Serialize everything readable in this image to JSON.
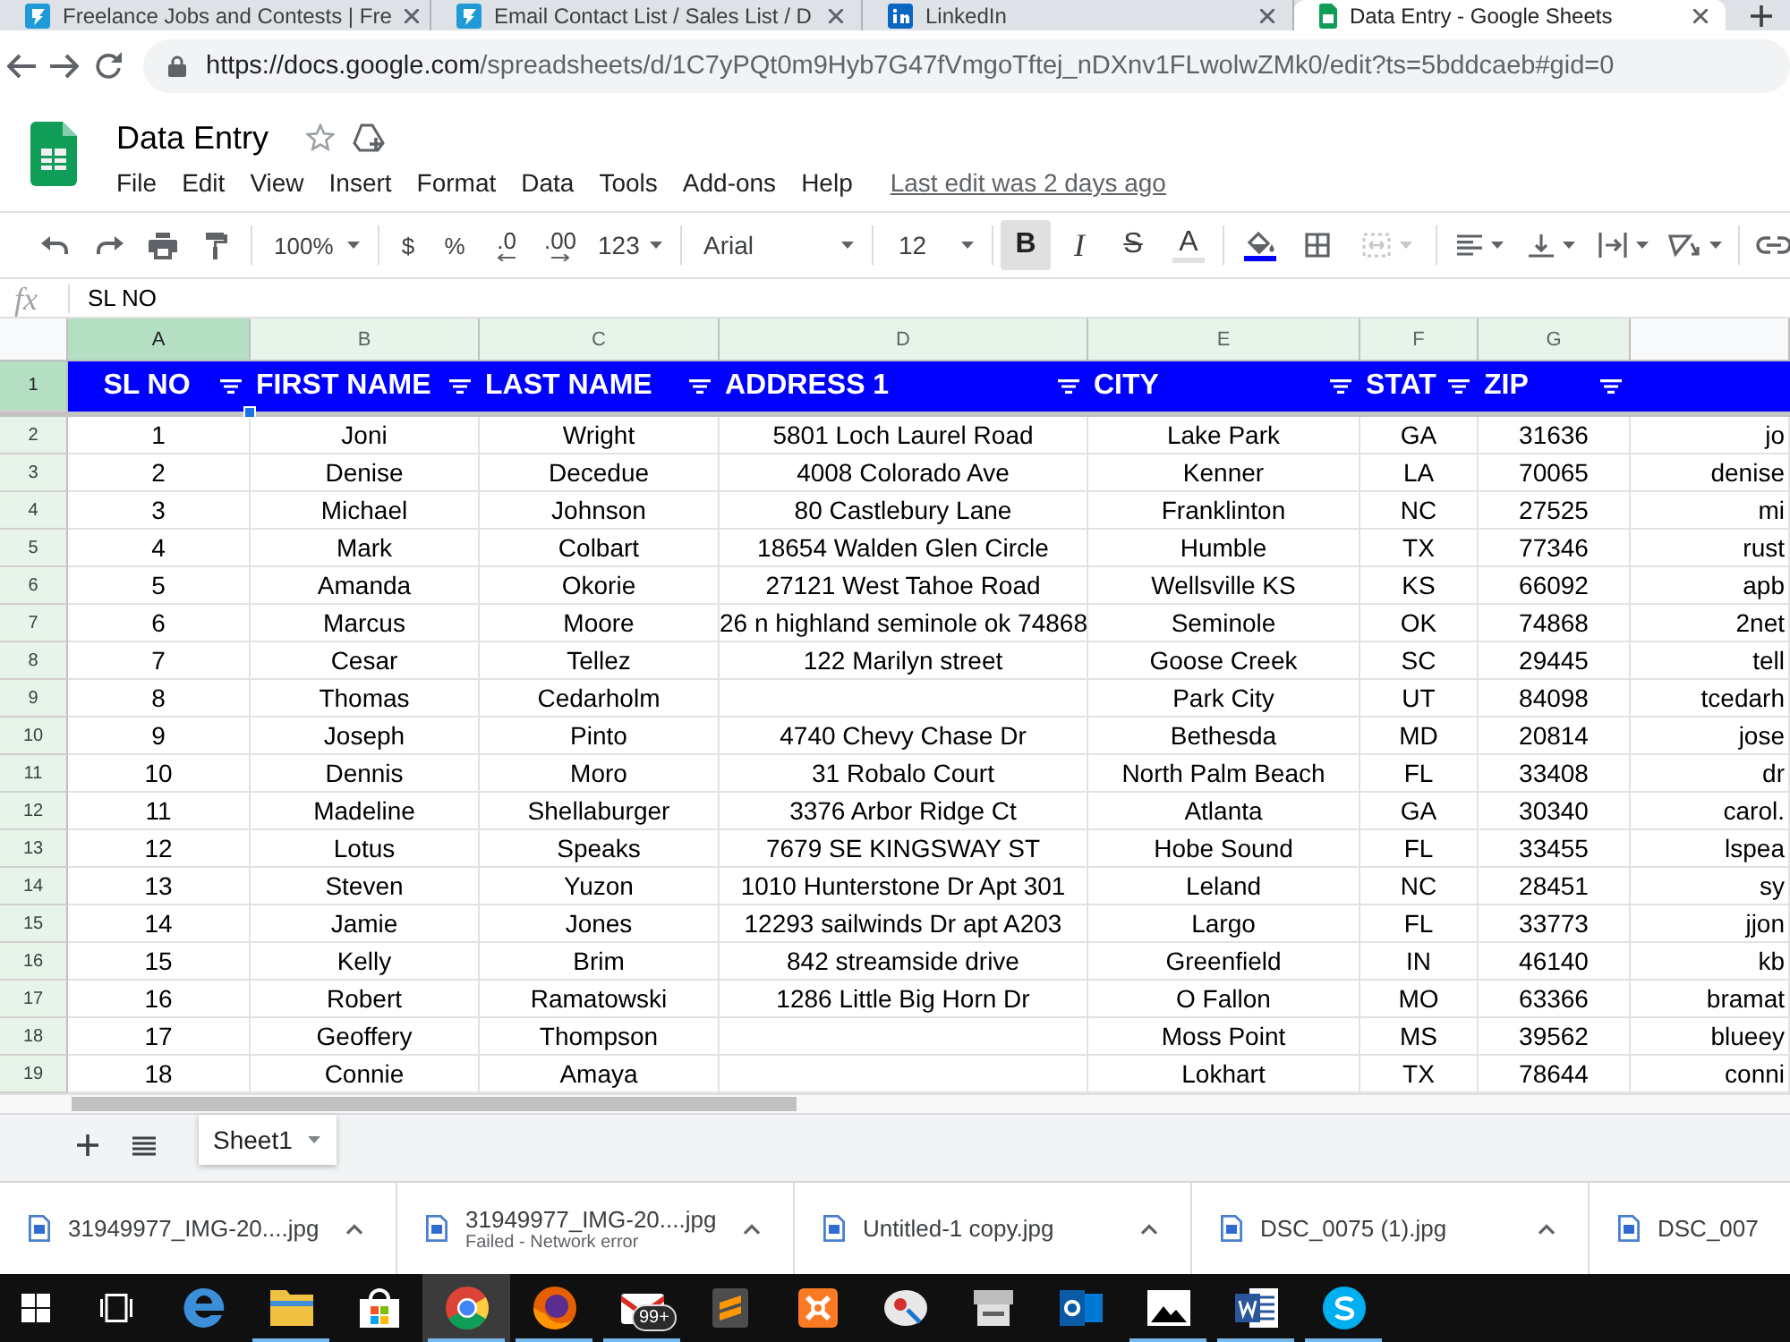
{
  "browser": {
    "tabs": [
      {
        "title": "Freelance Jobs and Contests | Fre",
        "kind": "freelancer",
        "selected": false
      },
      {
        "title": "Email Contact List / Sales List / D",
        "kind": "freelancer",
        "selected": false
      },
      {
        "title": "LinkedIn",
        "kind": "linkedin",
        "selected": false
      },
      {
        "title": "Data Entry - Google Sheets",
        "kind": "sheets",
        "selected": true
      }
    ],
    "address_bar": {
      "host": "https://docs.google.com",
      "path": "/spreadsheets/d/1C7yPQt0m9Hyb7G47fVmgoTftej_nDXnv1FLwolwZMk0/edit?ts=5bddcaeb#gid=0"
    }
  },
  "app": {
    "title": "Data Entry",
    "menu": [
      "File",
      "Edit",
      "View",
      "Insert",
      "Format",
      "Data",
      "Tools",
      "Add-ons",
      "Help"
    ],
    "last_edit": "Last edit was 2 days ago"
  },
  "toolbar": {
    "history": [
      {
        "kind": "undo"
      },
      {
        "kind": "redo"
      },
      {
        "kind": "print"
      },
      {
        "kind": "paint_format"
      }
    ],
    "zoom": "100%",
    "number": [
      {
        "kind": "currency",
        "label": "$"
      },
      {
        "kind": "percent",
        "label": "%"
      },
      {
        "kind": "decimal_less",
        "label": ".0"
      },
      {
        "kind": "decimal_more",
        "label": ".00"
      }
    ],
    "number_format": "123",
    "font": "Arial",
    "font_size": "12",
    "text_style": [
      {
        "kind": "bold",
        "label": "B",
        "selected": true
      },
      {
        "kind": "italic",
        "label": "I",
        "selected": false
      },
      {
        "kind": "strikethrough",
        "label": "S",
        "selected": false
      }
    ],
    "text_color": "A",
    "cell_tools": [
      {
        "kind": "fill_color",
        "disabled": false
      },
      {
        "kind": "borders",
        "disabled": false
      },
      {
        "kind": "merge",
        "disabled": true
      }
    ],
    "align_tools": [
      {
        "kind": "align"
      },
      {
        "kind": "valign"
      },
      {
        "kind": "wrap"
      },
      {
        "kind": "rotate"
      }
    ],
    "insert_tools": [
      {
        "kind": "link"
      }
    ]
  },
  "formula_bar": {
    "label": "fx",
    "value": "SL NO"
  },
  "sheet": {
    "columns": [
      {
        "letter": "A",
        "selected": true,
        "filtered": true
      },
      {
        "letter": "B",
        "selected": false,
        "filtered": true
      },
      {
        "letter": "C",
        "selected": false,
        "filtered": true
      },
      {
        "letter": "D",
        "selected": false,
        "filtered": true
      },
      {
        "letter": "E",
        "selected": false,
        "filtered": true
      },
      {
        "letter": "F",
        "selected": false,
        "filtered": true
      },
      {
        "letter": "G",
        "selected": false,
        "filtered": true
      },
      {
        "selected": false,
        "filtered": false
      }
    ],
    "header_row": {
      "number": "1",
      "selected": true,
      "filtered": true,
      "cells": [
        "SL NO",
        "FIRST NAME",
        "LAST NAME",
        "ADDRESS 1",
        "CITY",
        "STAT",
        "ZIP"
      ]
    },
    "rows": [
      {
        "number": "2",
        "selected": false,
        "filtered": true,
        "sl_no": "1",
        "first_name": "Joni",
        "last_name": "Wright",
        "address_1": "5801 Loch Laurel Road",
        "city": "Lake Park",
        "state": "GA",
        "zip": "31636",
        "column_8": "jo"
      },
      {
        "number": "3",
        "selected": false,
        "filtered": true,
        "sl_no": "2",
        "first_name": "Denise",
        "last_name": "Decedue",
        "address_1": "4008 Colorado Ave",
        "city": "Kenner",
        "state": "LA",
        "zip": "70065",
        "column_8": "denise"
      },
      {
        "number": "4",
        "selected": false,
        "filtered": true,
        "sl_no": "3",
        "first_name": "Michael",
        "last_name": "Johnson",
        "address_1": "80 Castlebury Lane",
        "city": "Franklinton",
        "state": "NC",
        "zip": "27525",
        "column_8": "mi"
      },
      {
        "number": "5",
        "selected": false,
        "filtered": true,
        "sl_no": "4",
        "first_name": "Mark",
        "last_name": "Colbart",
        "address_1": "18654 Walden Glen Circle",
        "city": "Humble",
        "state": "TX",
        "zip": "77346",
        "column_8": "rust"
      },
      {
        "number": "6",
        "selected": false,
        "filtered": true,
        "sl_no": "5",
        "first_name": "Amanda",
        "last_name": "Okorie",
        "address_1": "27121 West Tahoe Road",
        "city": "Wellsville KS",
        "state": "KS",
        "zip": "66092",
        "column_8": "apb"
      },
      {
        "number": "7",
        "selected": false,
        "filtered": true,
        "sl_no": "6",
        "first_name": "Marcus",
        "last_name": "Moore",
        "address_1": "26 n highland seminole ok 74868",
        "city": "Seminole",
        "state": "OK",
        "zip": "74868",
        "column_8": "2net"
      },
      {
        "number": "8",
        "selected": false,
        "filtered": true,
        "sl_no": "7",
        "first_name": "Cesar",
        "last_name": "Tellez",
        "address_1": "122 Marilyn street",
        "city": "Goose Creek",
        "state": "SC",
        "zip": "29445",
        "column_8": "tell"
      },
      {
        "number": "9",
        "selected": false,
        "filtered": true,
        "sl_no": "8",
        "first_name": "Thomas",
        "last_name": "Cedarholm",
        "city": "Park City",
        "state": "UT",
        "zip": "84098",
        "column_8": "tcedarh"
      },
      {
        "number": "10",
        "selected": false,
        "filtered": true,
        "sl_no": "9",
        "first_name": "Joseph",
        "last_name": "Pinto",
        "address_1": "4740 Chevy Chase Dr",
        "city": "Bethesda",
        "state": "MD",
        "zip": "20814",
        "column_8": "jose"
      },
      {
        "number": "11",
        "selected": false,
        "filtered": true,
        "sl_no": "10",
        "first_name": "Dennis",
        "last_name": "Moro",
        "address_1": "31 Robalo Court",
        "city": "North Palm Beach",
        "state": "FL",
        "zip": "33408",
        "column_8": "dr"
      },
      {
        "number": "12",
        "selected": false,
        "filtered": true,
        "sl_no": "11",
        "first_name": "Madeline",
        "last_name": "Shellaburger",
        "address_1": "3376 Arbor Ridge Ct",
        "city": "Atlanta",
        "state": "GA",
        "zip": "30340",
        "column_8": "carol."
      },
      {
        "number": "13",
        "selected": false,
        "filtered": true,
        "sl_no": "12",
        "first_name": "Lotus",
        "last_name": "Speaks",
        "address_1": "7679 SE KINGSWAY ST",
        "city": "Hobe Sound",
        "state": "FL",
        "zip": "33455",
        "column_8": "lspea"
      },
      {
        "number": "14",
        "selected": false,
        "filtered": true,
        "sl_no": "13",
        "first_name": "Steven",
        "last_name": "Yuzon",
        "address_1": "1010 Hunterstone Dr Apt 301",
        "city": "Leland",
        "state": "NC",
        "zip": "28451",
        "column_8": "sy"
      },
      {
        "number": "15",
        "selected": false,
        "filtered": true,
        "sl_no": "14",
        "first_name": "Jamie",
        "last_name": "Jones",
        "address_1": "12293 sailwinds Dr apt A203",
        "city": "Largo",
        "state": "FL",
        "zip": "33773",
        "column_8": "jjon"
      },
      {
        "number": "16",
        "selected": false,
        "filtered": true,
        "sl_no": "15",
        "first_name": "Kelly",
        "last_name": "Brim",
        "address_1": "842 streamside drive",
        "city": "Greenfield",
        "state": "IN",
        "zip": "46140",
        "column_8": "kb"
      },
      {
        "number": "17",
        "selected": false,
        "filtered": true,
        "sl_no": "16",
        "first_name": "Robert",
        "last_name": "Ramatowski",
        "address_1": "1286 Little Big Horn Dr",
        "city": "O Fallon",
        "state": "MO",
        "zip": "63366",
        "column_8": "bramat"
      },
      {
        "number": "18",
        "selected": false,
        "filtered": true,
        "sl_no": "17",
        "first_name": "Geoffery",
        "last_name": "Thompson",
        "city": "Moss Point",
        "state": "MS",
        "zip": "39562",
        "column_8": "blueey"
      },
      {
        "number": "19",
        "selected": false,
        "filtered": true,
        "sl_no": "18",
        "first_name": "Connie",
        "last_name": "Amaya",
        "city": "Lokhart",
        "state": "TX",
        "zip": "78644",
        "column_8": "conni"
      }
    ]
  },
  "sheet_tabs": [
    {
      "label": "Sheet1",
      "selected": true
    }
  ],
  "downloads": [
    {
      "file": "31949977_IMG-20....jpg"
    },
    {
      "file": "31949977_IMG-20....jpg",
      "status": "Failed - Network error"
    },
    {
      "file": "Untitled-1 copy.jpg"
    },
    {
      "file": "DSC_0075 (1).jpg"
    },
    {
      "file": "DSC_007"
    }
  ],
  "taskbar": [
    {
      "kind": "start",
      "running": false,
      "selected": false
    },
    {
      "kind": "task_view",
      "running": false,
      "selected": false
    },
    {
      "kind": "browser_e",
      "running": false,
      "selected": false
    },
    {
      "kind": "folder",
      "running": true,
      "selected": false
    },
    {
      "kind": "store",
      "running": false,
      "selected": false
    },
    {
      "kind": "browser_round",
      "running": true,
      "selected": true
    },
    {
      "kind": "browser_fox",
      "running": true,
      "selected": false
    },
    {
      "kind": "mail",
      "running": true,
      "selected": false,
      "badge": "99+"
    },
    {
      "kind": "editor",
      "running": false,
      "selected": false
    },
    {
      "kind": "server",
      "running": false,
      "selected": false
    },
    {
      "kind": "paint",
      "running": false,
      "selected": false
    },
    {
      "kind": "scanner",
      "running": false,
      "selected": false
    },
    {
      "kind": "mail_client",
      "running": false,
      "selected": false
    },
    {
      "kind": "photos",
      "running": true,
      "selected": false
    },
    {
      "kind": "word_processor",
      "running": true,
      "selected": false
    },
    {
      "kind": "chat",
      "running": true,
      "selected": false
    }
  ]
}
